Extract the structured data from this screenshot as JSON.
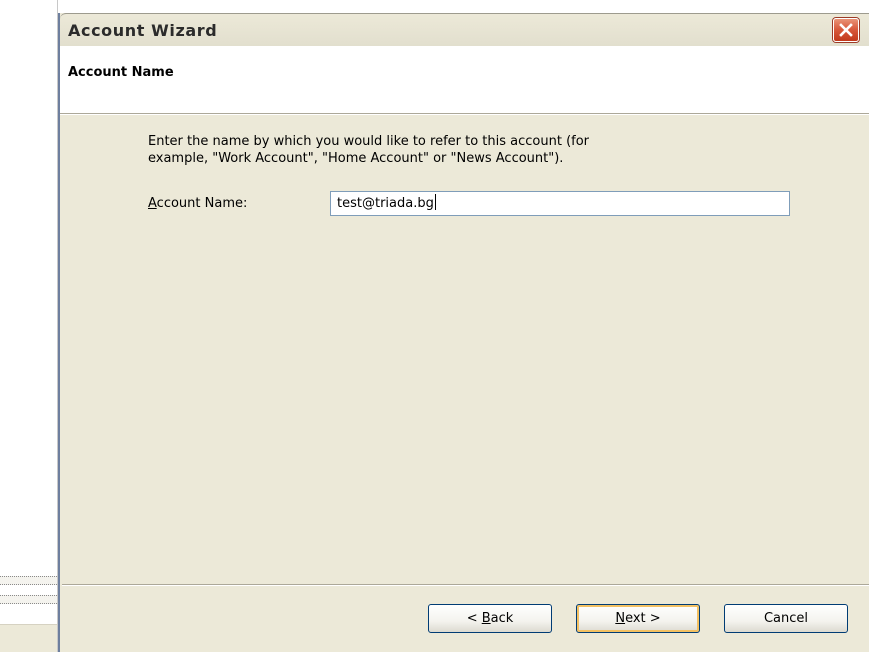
{
  "window": {
    "title": "Account Wizard"
  },
  "header": {
    "title": "Account Name"
  },
  "content": {
    "description_line1": "Enter the name by which you would like to refer to this account (for",
    "description_line2": "example, \"Work Account\", \"Home Account\" or \"News Account\").",
    "field_label_mnemonic": "A",
    "field_label_rest": "ccount Name:",
    "field_value": "test@triada.bg"
  },
  "buttons": {
    "back_prefix": "< ",
    "back_mnemonic": "B",
    "back_rest": "ack",
    "next_mnemonic": "N",
    "next_rest": "ext >",
    "cancel": "Cancel"
  },
  "icons": {
    "close": "close-icon"
  },
  "colors": {
    "close_button": "#d7573a",
    "dialog_background": "#ece9d8",
    "default_button_highlight": "#f3c163"
  }
}
